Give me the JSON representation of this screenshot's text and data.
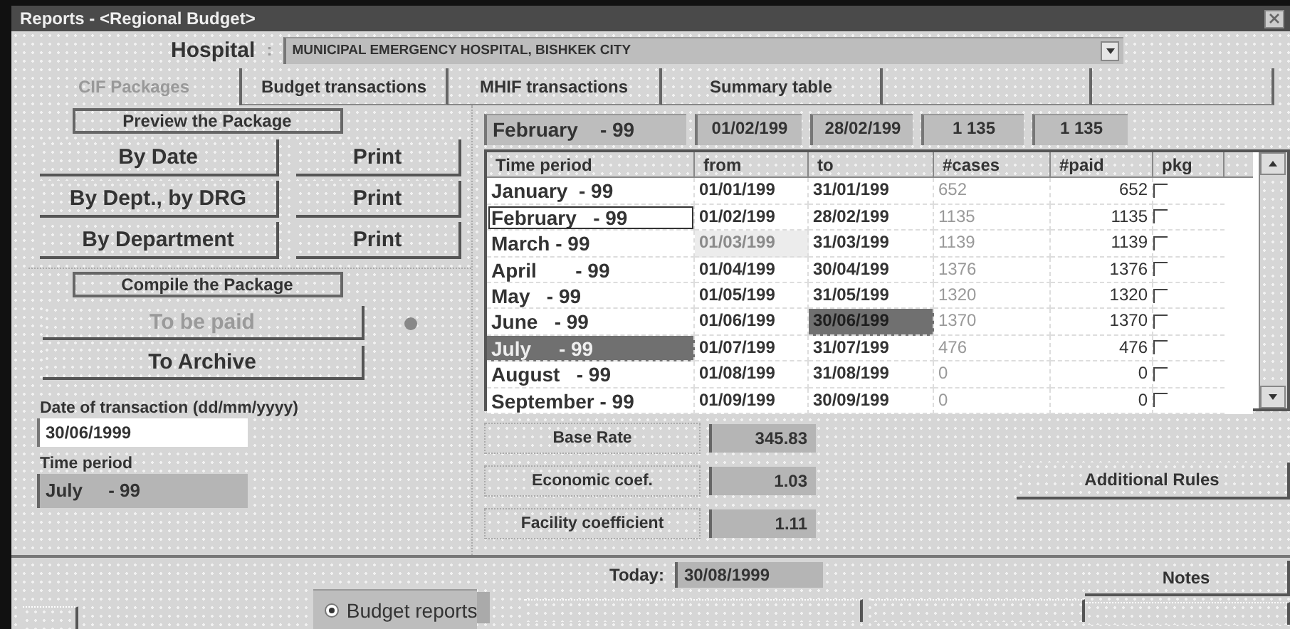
{
  "window": {
    "title": "Reports - <Regional Budget>"
  },
  "hospital": {
    "label": "Hospital",
    "separator": ":",
    "value": "MUNICIPAL EMERGENCY HOSPITAL, BISHKEK CITY"
  },
  "tabs": [
    {
      "label": "CIF Packages",
      "selected": true,
      "disabled": true
    },
    {
      "label": "Budget transactions",
      "selected": false,
      "disabled": false
    },
    {
      "label": "MHIF transactions",
      "selected": false,
      "disabled": false
    },
    {
      "label": "Summary table",
      "selected": false,
      "disabled": false
    }
  ],
  "preview": {
    "title": "Preview the Package",
    "rows": [
      {
        "report": "By Date",
        "print": "Print"
      },
      {
        "report": "By Dept., by DRG",
        "print": "Print"
      },
      {
        "report": "By Department",
        "print": "Print"
      }
    ]
  },
  "compile": {
    "title": "Compile the Package",
    "buttons": [
      {
        "label": "To be paid",
        "disabled": true
      },
      {
        "label": "To Archive",
        "disabled": false
      }
    ]
  },
  "transaction_date": {
    "label": "Date of transaction (dd/mm/yyyy)",
    "value": "30/06/1999"
  },
  "time_period": {
    "label": "Time period",
    "value": "July     - 99"
  },
  "current": [
    "February    - 99",
    "01/02/199",
    "28/02/199",
    "1 135",
    "1 135"
  ],
  "table": {
    "columns": [
      "Time period",
      "from",
      "to",
      "#cases",
      "#paid",
      "pkg"
    ],
    "rows": [
      {
        "period": "January  - 99",
        "from": "01/01/199",
        "to": "31/01/199",
        "cases": "652",
        "paid": "652",
        "pkg": false,
        "selected": false,
        "focused": false,
        "from_dimmed": false,
        "to_selected": false
      },
      {
        "period": "February   - 99",
        "from": "01/02/199",
        "to": "28/02/199",
        "cases": "1135",
        "paid": "1135",
        "pkg": false,
        "selected": false,
        "focused": true,
        "from_dimmed": false,
        "to_selected": false
      },
      {
        "period": "March - 99",
        "from": "01/03/199",
        "to": "31/03/199",
        "cases": "1139",
        "paid": "1139",
        "pkg": false,
        "selected": false,
        "focused": false,
        "from_dimmed": true,
        "to_selected": false
      },
      {
        "period": "April       - 99",
        "from": "01/04/199",
        "to": "30/04/199",
        "cases": "1376",
        "paid": "1376",
        "pkg": false,
        "selected": false,
        "focused": false,
        "from_dimmed": false,
        "to_selected": false
      },
      {
        "period": "May   - 99",
        "from": "01/05/199",
        "to": "31/05/199",
        "cases": "1320",
        "paid": "1320",
        "pkg": false,
        "selected": false,
        "focused": false,
        "from_dimmed": false,
        "to_selected": false
      },
      {
        "period": "June   - 99",
        "from": "01/06/199",
        "to": "30/06/199",
        "cases": "1370",
        "paid": "1370",
        "pkg": false,
        "selected": false,
        "focused": false,
        "from_dimmed": false,
        "to_selected": true
      },
      {
        "period": "July     - 99",
        "from": "01/07/199",
        "to": "31/07/199",
        "cases": "476",
        "paid": "476",
        "pkg": false,
        "selected": true,
        "focused": false,
        "from_dimmed": false,
        "to_selected": false
      },
      {
        "period": "August   - 99",
        "from": "01/08/199",
        "to": "31/08/199",
        "cases": "0",
        "paid": "0",
        "pkg": false,
        "selected": false,
        "focused": false,
        "from_dimmed": false,
        "to_selected": false
      },
      {
        "period": "September - 99",
        "from": "01/09/199",
        "to": "30/09/199",
        "cases": "0",
        "paid": "0",
        "pkg": false,
        "selected": false,
        "focused": false,
        "from_dimmed": false,
        "to_selected": false
      }
    ]
  },
  "rates": [
    {
      "label": "Base Rate",
      "value": "345.83"
    },
    {
      "label": "Economic coef.",
      "value": "1.03"
    },
    {
      "label": "Facility coefficient",
      "value": "1.11"
    }
  ],
  "additional_rules": "Additional Rules",
  "today": {
    "label": "Today:",
    "value": "30/08/1999"
  },
  "notes": "Notes",
  "report_type": {
    "label": "Budget reports",
    "selected": true
  }
}
